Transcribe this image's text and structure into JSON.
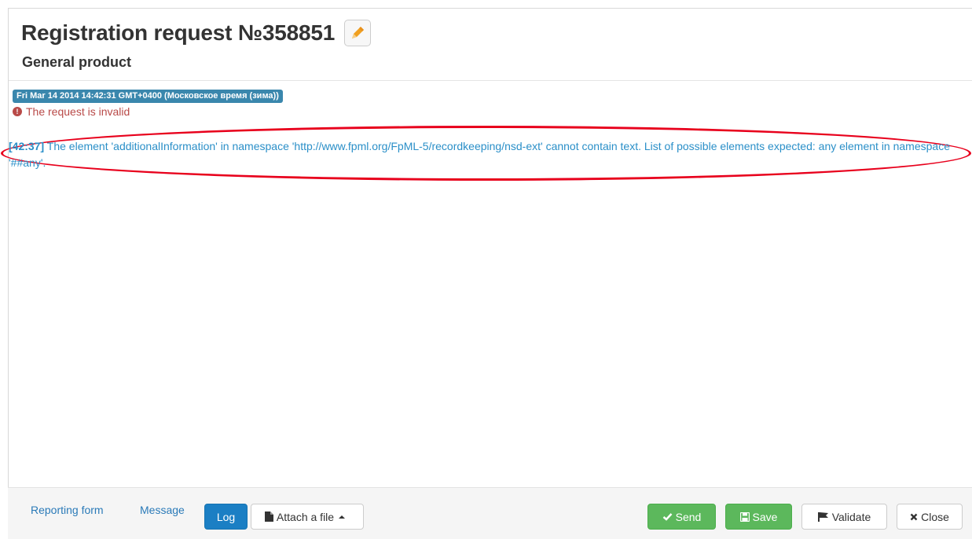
{
  "header": {
    "title": "Registration request №358851",
    "subtitle": "General product"
  },
  "log": {
    "date": "Fri Mar 14 2014 14:42:31 GMT+0400 (Московское время (зима))",
    "status": "The request is invalid",
    "error_code": "[42:37]",
    "error_message": "The element 'additionalInformation' in namespace 'http://www.fpml.org/FpML-5/recordkeeping/nsd-ext' cannot contain text. List of possible elements expected: any element in namespace '##any'."
  },
  "footer": {
    "tabs": [
      "Reporting form",
      "Message",
      "Log"
    ],
    "attach_label": "Attach a file",
    "send_label": "Send",
    "save_label": "Save",
    "validate_label": "Validate",
    "close_label": "Close"
  },
  "colors": {
    "accent": "#1b7fc4",
    "badge": "#3a87ad",
    "error_text": "#b94a48",
    "message_text": "#2a8fc8",
    "highlight": "#e8001c",
    "success": "#5cb85c"
  }
}
